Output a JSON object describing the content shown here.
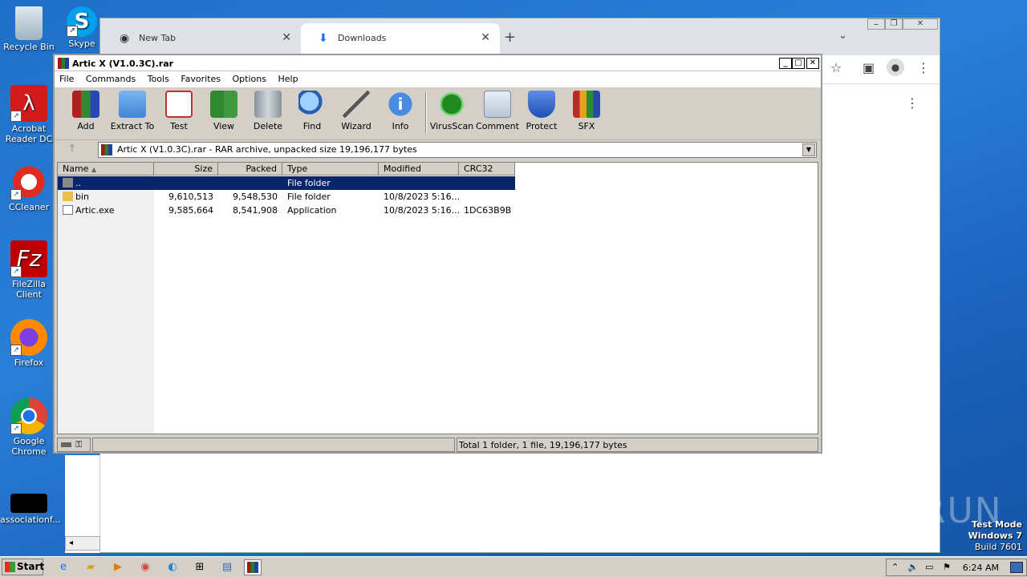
{
  "desktop": {
    "icons": [
      {
        "label": "Recycle Bin"
      },
      {
        "label": "Skype"
      },
      {
        "label": "Acrobat Reader DC"
      },
      {
        "label": "CCleaner"
      },
      {
        "label": "FileZilla Client"
      },
      {
        "label": "Firefox"
      },
      {
        "label": "Google Chrome"
      },
      {
        "label": "associationf..."
      }
    ]
  },
  "chrome": {
    "tabs": [
      {
        "label": "New Tab",
        "icon": "chrome-icon"
      },
      {
        "label": "Downloads",
        "icon": "download-icon"
      }
    ]
  },
  "winrar": {
    "title": "Artic X (V1.0.3C).rar",
    "menu": [
      "File",
      "Commands",
      "Tools",
      "Favorites",
      "Options",
      "Help"
    ],
    "toolbar": [
      "Add",
      "Extract To",
      "Test",
      "View",
      "Delete",
      "Find",
      "Wizard",
      "Info",
      "VirusScan",
      "Comment",
      "Protect",
      "SFX"
    ],
    "address": "Artic X (V1.0.3C).rar - RAR archive, unpacked size 19,196,177 bytes",
    "columns": [
      "Name",
      "Size",
      "Packed",
      "Type",
      "Modified",
      "CRC32"
    ],
    "rows": [
      {
        "name": "..",
        "size": "",
        "packed": "",
        "type": "File folder",
        "modified": "",
        "crc": ""
      },
      {
        "name": "bin",
        "size": "9,610,513",
        "packed": "9,548,530",
        "type": "File folder",
        "modified": "10/8/2023 5:16...",
        "crc": ""
      },
      {
        "name": "Artic.exe",
        "size": "9,585,664",
        "packed": "8,541,908",
        "type": "Application",
        "modified": "10/8/2023 5:16...",
        "crc": "1DC63B9B"
      }
    ],
    "status": "Total 1 folder, 1 file, 19,196,177 bytes"
  },
  "taskbar": {
    "start_label": "Start",
    "clock": "6:24 AM"
  },
  "watermark": {
    "brand": "ANY RUN",
    "line1": "Test Mode",
    "line2": "Windows 7",
    "line3": "Build 7601"
  }
}
